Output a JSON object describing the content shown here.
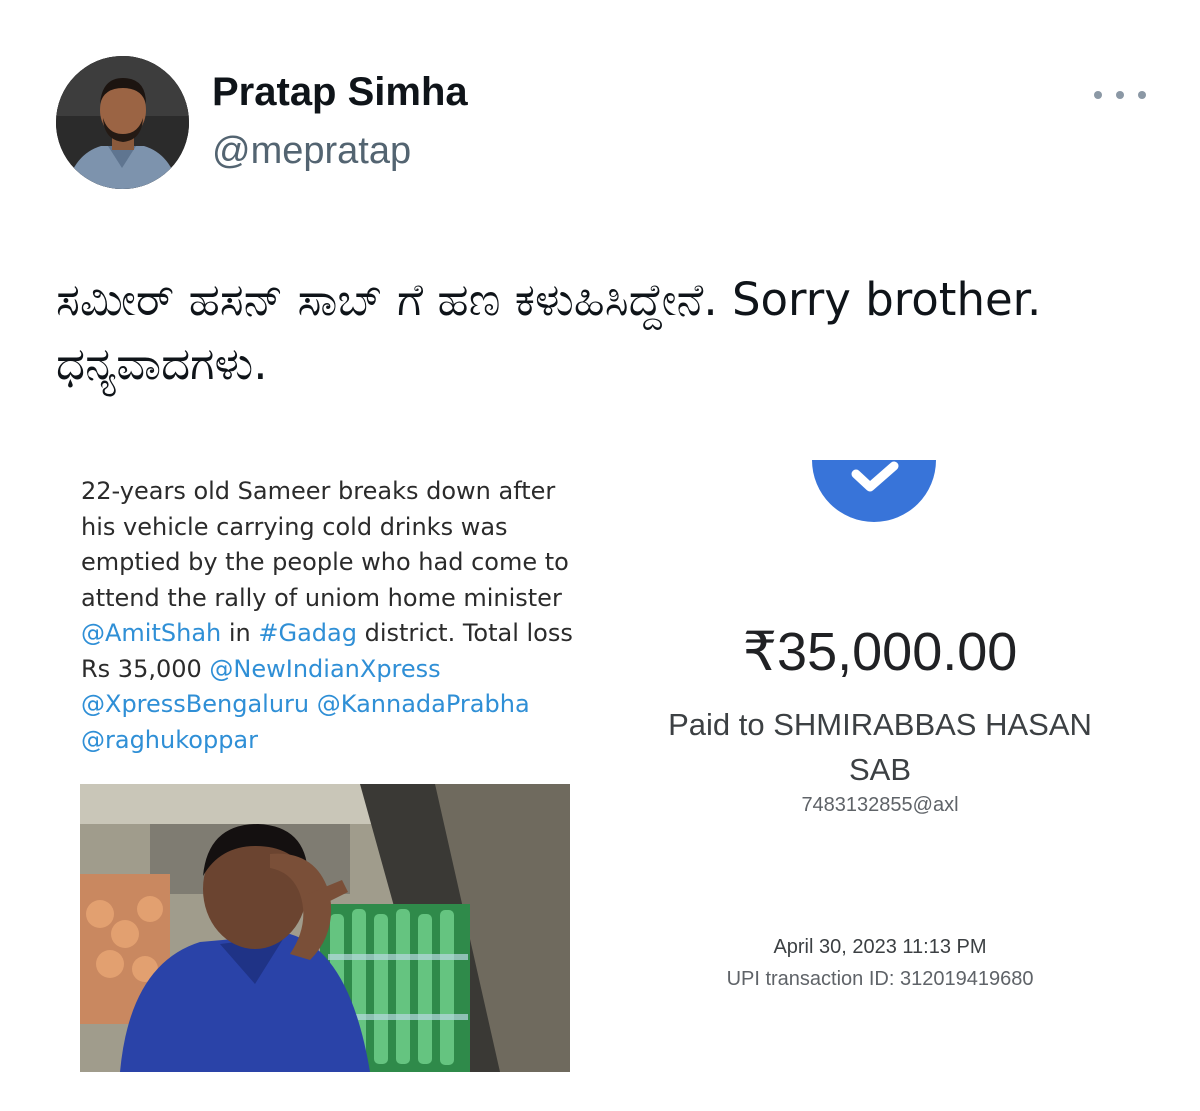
{
  "tweet": {
    "author_name": "Pratap Simha",
    "author_handle": "@mepratap",
    "more_icon": "more-horizontal-icon",
    "text": "ಸಮೀರ್ ಹಸನ್ ಸಾಬ್ ಗೆ ಹಣ ಕಳುಹಿಸಿದ್ದೇನೆ. Sorry brother. ಧನ್ಯವಾದಗಳು."
  },
  "news_card": {
    "text_before_link1": "22-years old Sameer breaks down after his vehicle carrying cold drinks was emptied by the people who had come to attend the rally of uniom home minister ",
    "link1": "@AmitShah",
    "text_mid1": " in ",
    "link2": "#Gadag",
    "text_mid2": " district. Total loss Rs 35,000 ",
    "link3": "@NewIndianXpress",
    "link4": "@XpressBengaluru",
    "link5": "@KannadaPrabha",
    "link6": "@raghukoppar"
  },
  "payment": {
    "amount": "₹35,000.00",
    "paid_to": "Paid to SHMIRABBAS HASAN SAB",
    "upi_id": "7483132855@axl",
    "datetime": "April 30, 2023 11:13 PM",
    "transaction_id": "UPI transaction ID: 312019419680",
    "check_icon": "check-circle-icon",
    "accent_color": "#3874d9"
  },
  "colors": {
    "link": "#2f8fd6",
    "secondary_text": "#536471"
  }
}
